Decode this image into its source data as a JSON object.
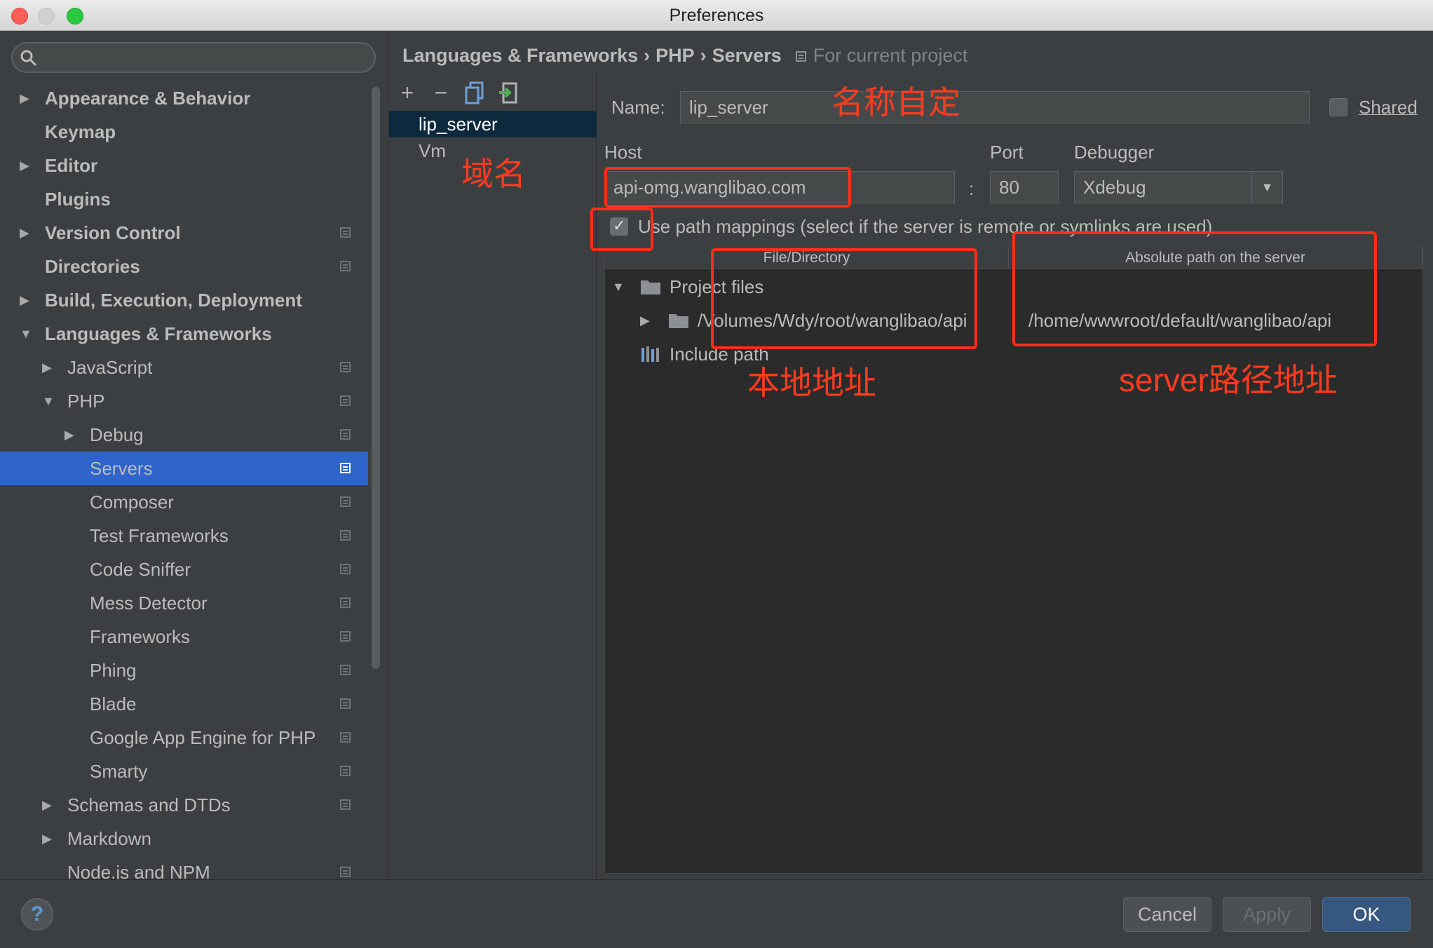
{
  "window": {
    "title": "Preferences"
  },
  "search": {
    "placeholder": ""
  },
  "sidebar": {
    "items": [
      {
        "label": "Appearance & Behavior",
        "bold": true,
        "arrow": "right",
        "indent": 0,
        "proj": false
      },
      {
        "label": "Keymap",
        "bold": true,
        "arrow": "",
        "indent": 0,
        "proj": false
      },
      {
        "label": "Editor",
        "bold": true,
        "arrow": "right",
        "indent": 0,
        "proj": false
      },
      {
        "label": "Plugins",
        "bold": true,
        "arrow": "",
        "indent": 0,
        "proj": false
      },
      {
        "label": "Version Control",
        "bold": true,
        "arrow": "right",
        "indent": 0,
        "proj": true
      },
      {
        "label": "Directories",
        "bold": true,
        "arrow": "",
        "indent": 0,
        "proj": true
      },
      {
        "label": "Build, Execution, Deployment",
        "bold": true,
        "arrow": "right",
        "indent": 0,
        "proj": false
      },
      {
        "label": "Languages & Frameworks",
        "bold": true,
        "arrow": "down",
        "indent": 0,
        "proj": false
      },
      {
        "label": "JavaScript",
        "bold": false,
        "arrow": "right",
        "indent": 1,
        "proj": true
      },
      {
        "label": "PHP",
        "bold": false,
        "arrow": "down",
        "indent": 1,
        "proj": true
      },
      {
        "label": "Debug",
        "bold": false,
        "arrow": "right",
        "indent": 2,
        "proj": true
      },
      {
        "label": "Servers",
        "bold": false,
        "arrow": "",
        "indent": 2,
        "proj": true,
        "selected": true
      },
      {
        "label": "Composer",
        "bold": false,
        "arrow": "",
        "indent": 2,
        "proj": true
      },
      {
        "label": "Test Frameworks",
        "bold": false,
        "arrow": "",
        "indent": 2,
        "proj": true
      },
      {
        "label": "Code Sniffer",
        "bold": false,
        "arrow": "",
        "indent": 2,
        "proj": true
      },
      {
        "label": "Mess Detector",
        "bold": false,
        "arrow": "",
        "indent": 2,
        "proj": true
      },
      {
        "label": "Frameworks",
        "bold": false,
        "arrow": "",
        "indent": 2,
        "proj": true
      },
      {
        "label": "Phing",
        "bold": false,
        "arrow": "",
        "indent": 2,
        "proj": true
      },
      {
        "label": "Blade",
        "bold": false,
        "arrow": "",
        "indent": 2,
        "proj": true
      },
      {
        "label": "Google App Engine for PHP",
        "bold": false,
        "arrow": "",
        "indent": 2,
        "proj": true
      },
      {
        "label": "Smarty",
        "bold": false,
        "arrow": "",
        "indent": 2,
        "proj": true
      },
      {
        "label": "Schemas and DTDs",
        "bold": false,
        "arrow": "right",
        "indent": 1,
        "proj": true
      },
      {
        "label": "Markdown",
        "bold": false,
        "arrow": "right",
        "indent": 1,
        "proj": false
      },
      {
        "label": "Node.js and NPM",
        "bold": false,
        "arrow": "",
        "indent": 1,
        "proj": true
      }
    ]
  },
  "breadcrumb": {
    "part1": "Languages & Frameworks",
    "sep": "›",
    "part2": "PHP",
    "part3": "Servers",
    "scope": "For current project"
  },
  "servers_toolbar": {
    "add": "+",
    "remove": "−"
  },
  "servers": [
    "lip_server",
    "Vm"
  ],
  "form": {
    "name_label": "Name:",
    "name_value": "lip_server",
    "shared_label": "Shared",
    "host_label": "Host",
    "host_value": "api-omg.wanglibao.com",
    "port_label": "Port",
    "port_sep": ":",
    "port_value": "80",
    "debugger_label": "Debugger",
    "debugger_value": "Xdebug",
    "use_path_mappings_label": "Use path mappings (select if the server is remote or symlinks are used)",
    "use_path_mappings_checked": true
  },
  "mappings": {
    "col_local": "File/Directory",
    "col_remote": "Absolute path on the server",
    "project_files": "Project files",
    "local_path": "/Volumes/Wdy/root/wanglibao/api",
    "remote_path": "/home/wwwroot/default/wanglibao/api",
    "include_path": "Include path"
  },
  "buttons": {
    "help": "?",
    "cancel": "Cancel",
    "apply": "Apply",
    "ok": "OK"
  },
  "annotations": {
    "name_note": "名称自定",
    "domain_note": "域名",
    "local_note": "本地地址",
    "server_note": "server路径地址"
  },
  "colors": {
    "accent_selected": "#2f65ca",
    "annotation_red": "#ff2d1a"
  }
}
